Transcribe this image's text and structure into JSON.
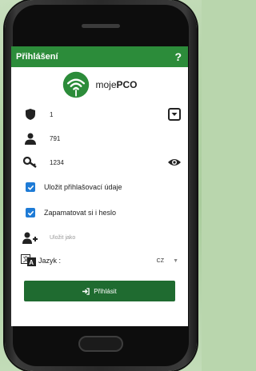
{
  "app": {
    "title": "Přihlášení",
    "help_icon": "?"
  },
  "logo": {
    "prefix": "moje",
    "brand": "PCO"
  },
  "fields": {
    "site": "1",
    "user": "791",
    "password": "1234"
  },
  "options": {
    "save_credentials": "Uložit přihlašovací údaje",
    "remember_password": "Zapamatovat si i heslo",
    "save_as_placeholder": "Uložit jako"
  },
  "language": {
    "label": "Jazyk :",
    "selected": "CZ"
  },
  "actions": {
    "login_label": "Přihlásit"
  },
  "colors": {
    "appbar": "#2c8c3a",
    "button": "#1f6b30",
    "checkbox": "#1e7bd6"
  },
  "icons": [
    "shield-icon",
    "dropdown-icon",
    "user-icon",
    "key-icon",
    "eye-icon",
    "add-user-icon",
    "translate-icon",
    "login-icon",
    "check-icon"
  ]
}
